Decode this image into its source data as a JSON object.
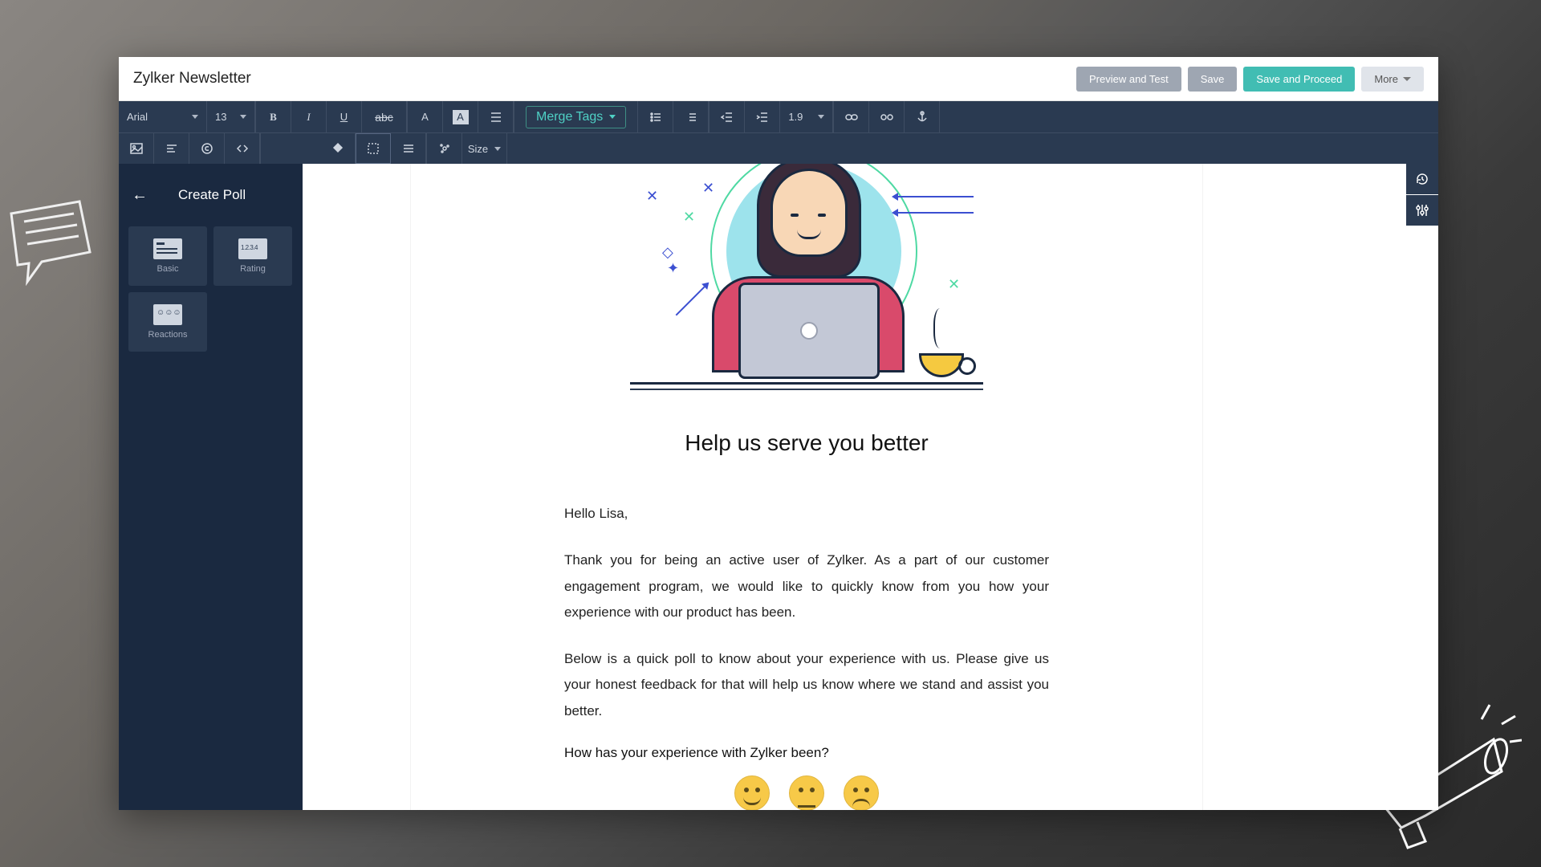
{
  "header": {
    "title": "Zylker Newsletter",
    "actions": {
      "preview": "Preview and Test",
      "save": "Save",
      "saveProceed": "Save and Proceed",
      "more": "More"
    }
  },
  "toolbar": {
    "font": "Arial",
    "fontSize": "13",
    "mergeTags": "Merge Tags",
    "lineHeight": "1.9",
    "sizeLabel": "Size",
    "strike": "abc"
  },
  "sidebar": {
    "title": "Create Poll",
    "tiles": [
      {
        "label": "Basic",
        "icon": "basic"
      },
      {
        "label": "Rating",
        "icon": "rating"
      },
      {
        "label": "Reactions",
        "icon": "reactions"
      }
    ]
  },
  "content": {
    "heading": "Help us serve you better",
    "greeting": "Hello Lisa,",
    "para1": "Thank you for being an active user of Zylker. As a part of our customer engagement program, we would like to quickly know from you how your experience with our product has been.",
    "para2": "Below is a quick poll to know about your experience with us. Please give us your honest feedback for that will help us know where we stand and assist you better.",
    "question": "How has your experience with Zylker been?",
    "reactions": [
      {
        "label": "Happy",
        "cls": "happy"
      },
      {
        "label": "Neutral",
        "cls": "neutral"
      },
      {
        "label": "Upset",
        "cls": "upset"
      }
    ]
  }
}
